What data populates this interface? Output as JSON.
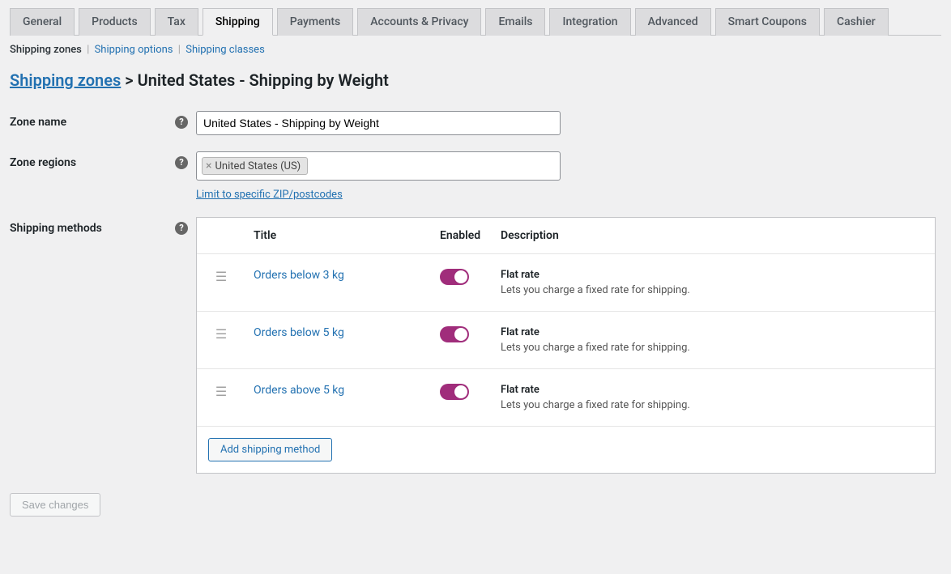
{
  "tabs": [
    {
      "label": "General"
    },
    {
      "label": "Products"
    },
    {
      "label": "Tax"
    },
    {
      "label": "Shipping",
      "active": true
    },
    {
      "label": "Payments"
    },
    {
      "label": "Accounts & Privacy"
    },
    {
      "label": "Emails"
    },
    {
      "label": "Integration"
    },
    {
      "label": "Advanced"
    },
    {
      "label": "Smart Coupons"
    },
    {
      "label": "Cashier"
    }
  ],
  "subnav": {
    "current": "Shipping zones",
    "links": [
      "Shipping options",
      "Shipping classes"
    ]
  },
  "breadcrumb": {
    "root": "Shipping zones",
    "sep": ">",
    "current": "United States - Shipping by Weight"
  },
  "form": {
    "zone_name_label": "Zone name",
    "zone_name_value": "United States - Shipping by Weight",
    "zone_regions_label": "Zone regions",
    "zone_regions_chip": "United States (US)",
    "zip_link": "Limit to specific ZIP/postcodes",
    "methods_label": "Shipping methods",
    "help_glyph": "?"
  },
  "methods_table": {
    "headers": {
      "title": "Title",
      "enabled": "Enabled",
      "description": "Description"
    },
    "rows": [
      {
        "title": "Orders below 3 kg",
        "enabled": true,
        "desc_head": "Flat rate",
        "desc_body": "Lets you charge a fixed rate for shipping."
      },
      {
        "title": "Orders below 5 kg",
        "enabled": true,
        "desc_head": "Flat rate",
        "desc_body": "Lets you charge a fixed rate for shipping."
      },
      {
        "title": "Orders above 5 kg",
        "enabled": true,
        "desc_head": "Flat rate",
        "desc_body": "Lets you charge a fixed rate for shipping."
      }
    ],
    "add_button": "Add shipping method"
  },
  "save_button": "Save changes"
}
